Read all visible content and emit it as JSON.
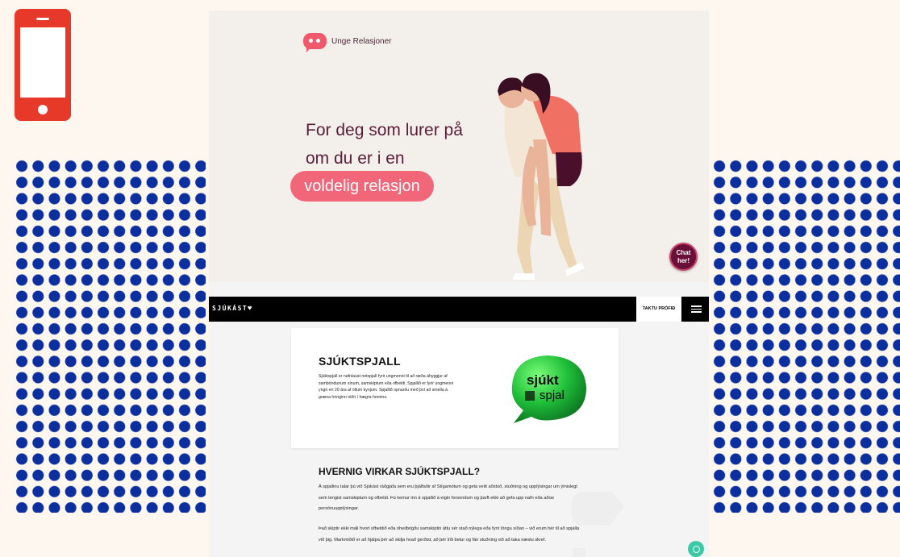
{
  "colors": {
    "background": "#fdf7f0",
    "phone_icon": "#e6392a",
    "dots": "#0b2f9e",
    "accent_pink": "#f2667a",
    "accent_maroon": "#6a1038",
    "nav_black": "#000000",
    "help_green": "#3cc9a8"
  },
  "icons": {
    "phone": "smartphone-icon",
    "brand": "speech-bubble-icon",
    "menu": "hamburger-menu-icon",
    "help": "chat-circle-icon"
  },
  "top_panel": {
    "brand_name": "Unge Relasjoner",
    "hero_line_1": "For deg som lurer på",
    "hero_line_2": "om du er i en",
    "hero_highlight": "voldelig relasjon",
    "chat_label_1": "Chat",
    "chat_label_2": "her!"
  },
  "bottom_panel": {
    "nav": {
      "logo": "SJÚKÁST♥",
      "cta": "TAKTU PRÓFIÐ"
    },
    "card": {
      "title": "SJÚKTSPJALL",
      "body": "Sjúktspjall er nafnlaust netspjall fyrir ungmenni til að ræða áhyggjur af samböndunum sínum, samskiptum eða ofbeldi. Spjallið er fyrir ungmenni yngri en 20 ára af öllum kynjum. Spjallið opnarðu með því að smella á græna hringinn niðri í hægra horninu.",
      "balloon_text_1": "sjúkt",
      "balloon_text_2": "spjal"
    },
    "section_title": "HVERNIG VIRKAR SJÚKTSPJALL?",
    "paragraph_1": "Á spjallinu talar þú við Sjúkást ráðgjafa sem eru þjálfaðir af Stígamótum og geta veitt aðstoð, stuðning og upplýsingar um ýmislegt sem tengist samskiptum og ofbeldi. Þú kemur inn á spjallið á eigin forsendum og þarft ekki að gefa upp nafn eða aðrar persónuupplýsingar.",
    "paragraph_2": "Það skiptir ekki máli hvort ofbeldið eða óheilbrigðu samskiptin áttu sér stað nýlega eða fyrir löngu síðan – við erum hér til að spjalla við þig. Markmiðið er að hjálpa þér að skilja hvað gerðist, að þér líði betur og fáir stuðning við að taka næstu skref."
  }
}
